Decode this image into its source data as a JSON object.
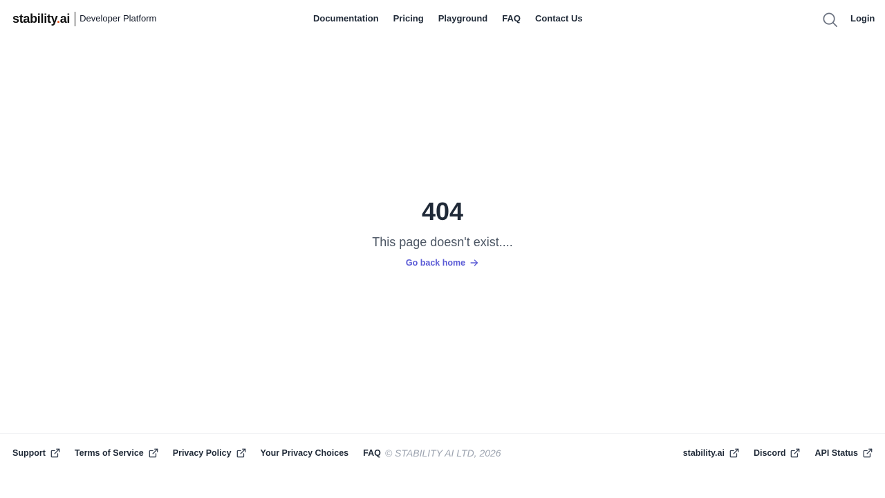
{
  "header": {
    "logo_text": "stability",
    "logo_dot": ".",
    "logo_suffix": "ai",
    "subtitle": "Developer Platform",
    "nav": [
      {
        "label": "Documentation"
      },
      {
        "label": "Pricing"
      },
      {
        "label": "Playground"
      },
      {
        "label": "FAQ"
      },
      {
        "label": "Contact Us"
      }
    ],
    "search_icon": "search-icon",
    "login_label": "Login"
  },
  "main": {
    "code": "404",
    "message": "This page doesn't exist....",
    "home_link": "Go back home",
    "home_icon": "arrow-right-icon"
  },
  "footer": {
    "left_links": [
      {
        "label": "Support",
        "external": true
      },
      {
        "label": "Terms of Service",
        "external": true
      },
      {
        "label": "Privacy Policy",
        "external": true
      },
      {
        "label": "Your Privacy Choices",
        "external": false
      },
      {
        "label": "FAQ",
        "external": false
      }
    ],
    "copyright": "© STABILITY AI LTD, 2026",
    "right_links": [
      {
        "label": "stability.ai",
        "external": true
      },
      {
        "label": "Discord",
        "external": true
      },
      {
        "label": "API Status",
        "external": true
      }
    ]
  },
  "colors": {
    "accent": "#5b5bd6",
    "logo_dot": "#e4521b",
    "text": "#1f2937",
    "muted": "#9ca3af"
  }
}
